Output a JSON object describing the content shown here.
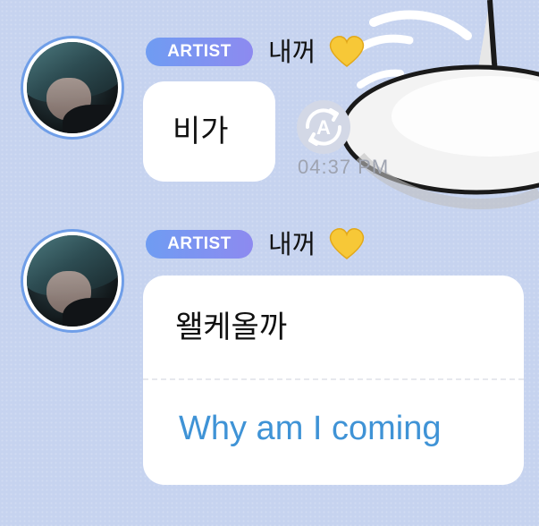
{
  "messages": [
    {
      "badge": "ARTIST",
      "sender": "내꺼",
      "text": "비가",
      "time": "04:37 PM"
    },
    {
      "badge": "ARTIST",
      "sender": "내꺼",
      "text": "왤케올까",
      "translation": "Why am I coming"
    }
  ],
  "icons": {
    "heart": "yellow-heart-icon",
    "translate": "auto-translate-icon"
  },
  "colors": {
    "background": "#c6d3ef",
    "badge": "#7b95f1",
    "translation_text": "#3f93d6",
    "time_text": "#9ea3b0"
  }
}
